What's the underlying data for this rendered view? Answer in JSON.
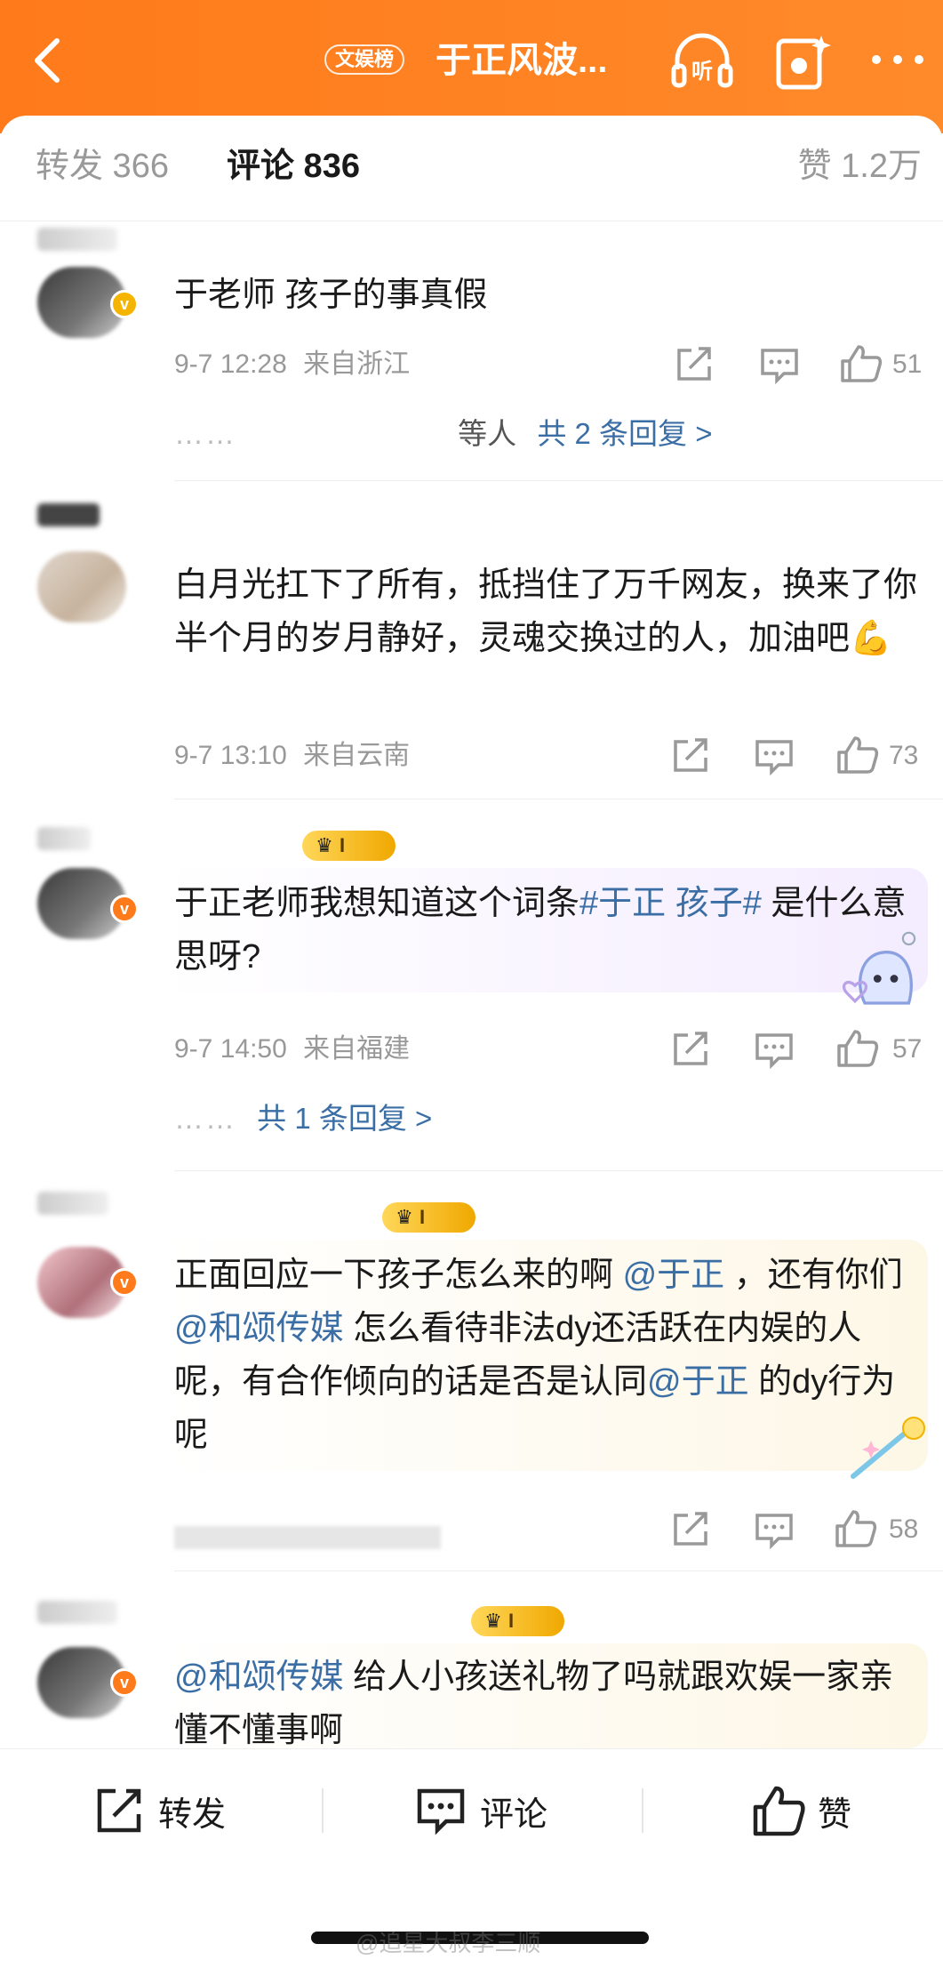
{
  "header": {
    "back_icon": "chevron-left-icon",
    "category_pill": "文娱榜",
    "title": "于正风波...",
    "listen_label": "听",
    "accent_color": "#ff7a1a"
  },
  "tabs": {
    "repost": "转发 366",
    "comment": "评论 836",
    "likes": "赞 1.2万"
  },
  "comments": [
    {
      "text": "于老师 孩子的事真假",
      "time": "9-7 12:28",
      "location": "来自浙江",
      "likes": "51",
      "reply_who": "等人",
      "reply_link": "共 2 条回复 >"
    },
    {
      "text": "白月光扛下了所有，抵挡住了万千网友，换来了你半个月的岁月静好，灵魂交换过的人，加油吧💪",
      "time": "9-7 13:10",
      "location": "来自云南",
      "likes": "73"
    },
    {
      "level": "I",
      "text_before": "于正老师我想知道这个词条",
      "topic": "#于正 孩子#",
      "text_after": " 是什么意思呀?",
      "time": "9-7 14:50",
      "location": "来自福建",
      "likes": "57",
      "reply_link": "共 1 条回复 >"
    },
    {
      "level": "I",
      "p1": "正面回应一下孩子怎么来的啊 ",
      "at1": "@于正",
      "p2": " ，还有你们",
      "at2": "@和颂传媒",
      "p3": " 怎么看待非法dy还活跃在内娱的人呢，有合作倾向的话是否是认同",
      "at3": "@于正",
      "p4": " 的dy行为呢",
      "likes": "58"
    },
    {
      "level": "I",
      "at1": "@和颂传媒",
      "p1": " 给人小孩送礼物了吗就跟欢娱一家亲懂不懂事啊"
    }
  ],
  "bottom_bar": {
    "repost": "转发",
    "comment": "评论",
    "like": "赞"
  },
  "watermark": "@追星大叔李三顺"
}
